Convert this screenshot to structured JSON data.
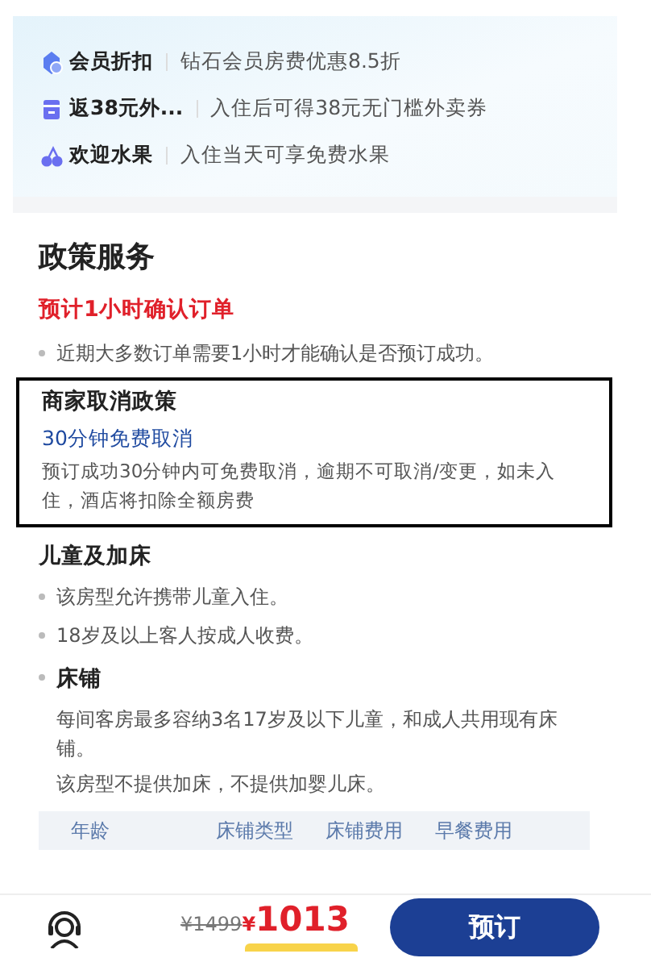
{
  "benefits": [
    {
      "kind": "discount",
      "title": "会员折扣",
      "desc": "钻石会员房费优惠8.5折"
    },
    {
      "kind": "coupon",
      "title": "返38元外...",
      "desc": "入住后可得38元无门槛外卖券"
    },
    {
      "kind": "fruit",
      "title": "欢迎水果",
      "desc": "入住当天可享免费水果"
    }
  ],
  "policy": {
    "title": "政策服务",
    "confirm": {
      "title": "预计1小时确认订单",
      "bullets": [
        "近期大多数订单需要1小时才能确认是否预订成功。"
      ]
    },
    "cancel": {
      "title": "商家取消政策",
      "subtitle": "30分钟免费取消",
      "text": "预订成功30分钟内可免费取消，逾期不可取消/变更，如未入住，酒店将扣除全额房费"
    },
    "children": {
      "title": "儿童及加床",
      "bullets": [
        "该房型允许携带儿童入住。",
        "18岁及以上客人按成人收费。"
      ],
      "bed": {
        "title": "床铺",
        "paragraphs": [
          "每间客房最多容纳3名17岁及以下儿童，和成人共用现有床铺。",
          "该房型不提供加床，不提供加婴儿床。"
        ]
      },
      "table": {
        "columns": [
          "年龄",
          "床铺类型",
          "床铺费用",
          "早餐费用"
        ]
      }
    }
  },
  "footer": {
    "original_price": "¥1499",
    "currency": "¥",
    "price": "1013",
    "book_button": "预订"
  }
}
